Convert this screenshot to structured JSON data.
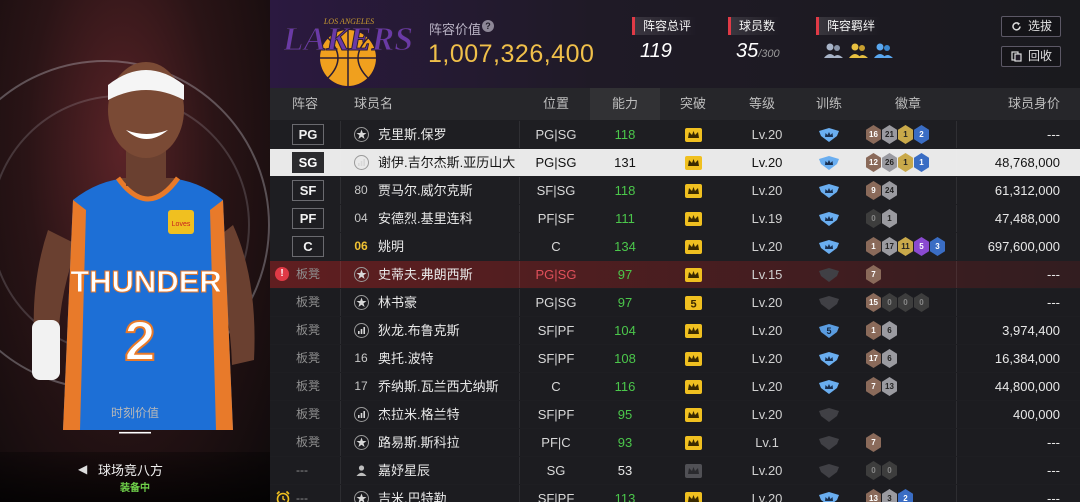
{
  "left_panel": {
    "moment_value_label": "时刻价值",
    "moment_value": "——",
    "court_name": "球场竞八方",
    "court_status": "装备中",
    "jersey_team": "THUNDER",
    "jersey_number": "2",
    "jersey_patch": "Loves"
  },
  "header": {
    "team_logo_text": "LAKERS",
    "team_logo_top": "LOS ANGELES",
    "lineup_value_label": "阵容价值",
    "help_icon": "?",
    "lineup_value": "1,007,326,400",
    "rating_label": "阵容总评",
    "rating_value": "119",
    "player_count_label": "球员数",
    "player_count_value": "35",
    "player_count_max": "/300",
    "bond_label": "阵容羁绊",
    "bond_icons": [
      "team-bond-icon-silver",
      "team-bond-icon-gold",
      "team-bond-icon-blue"
    ],
    "select_button": "选拔",
    "recycle_button": "回收"
  },
  "table": {
    "headers": {
      "role": "阵容",
      "name": "球员名",
      "position": "位置",
      "ability": "能力",
      "breakthrough": "突破",
      "level": "等级",
      "training": "训练",
      "badges": "徽章",
      "value": "球员身价"
    },
    "rows": [
      {
        "role": "PG",
        "type": "starter",
        "mark": "star",
        "name": "克里斯.保罗",
        "pos": "PG|SG",
        "ability": "118",
        "brk": "crown",
        "lv": "Lv.20",
        "train": "blue",
        "badges": [
          [
            "16",
            "bronze"
          ],
          [
            "21",
            "silver"
          ],
          [
            "1",
            "gold"
          ],
          [
            "2",
            "blue"
          ]
        ],
        "value": "---"
      },
      {
        "role": "SG",
        "type": "selected",
        "mark": "bars",
        "name": "谢伊.吉尔杰斯.亚历山大",
        "pos": "PG|SG",
        "ability": "131",
        "brk": "crown",
        "lv": "Lv.20",
        "train": "blue",
        "badges": [
          [
            "12",
            "bronze"
          ],
          [
            "26",
            "silver"
          ],
          [
            "1",
            "gold"
          ],
          [
            "1",
            "blue"
          ]
        ],
        "value": "48,768,000"
      },
      {
        "role": "SF",
        "type": "starter",
        "mark": "num",
        "num": "80",
        "name": "贾马尔.威尔克斯",
        "pos": "SF|SG",
        "ability": "118",
        "brk": "crown",
        "lv": "Lv.20",
        "train": "blue",
        "badges": [
          [
            "9",
            "bronze"
          ],
          [
            "24",
            "silver"
          ]
        ],
        "value": "61,312,000"
      },
      {
        "role": "PF",
        "type": "starter",
        "mark": "num",
        "num": "04",
        "name": "安德烈.基里连科",
        "pos": "PF|SF",
        "ability": "111",
        "brk": "crown",
        "lv": "Lv.19",
        "train": "blue",
        "badges": [
          [
            "0",
            "dark"
          ],
          [
            "1",
            "silver"
          ]
        ],
        "value": "47,488,000"
      },
      {
        "role": "C",
        "type": "starter",
        "mark": "num",
        "num": "06",
        "numgold": true,
        "name": "姚明",
        "pos": "C",
        "ability": "134",
        "brk": "crown",
        "lv": "Lv.20",
        "train": "blue",
        "badges": [
          [
            "1",
            "bronze"
          ],
          [
            "17",
            "silver"
          ],
          [
            "11",
            "gold"
          ],
          [
            "5",
            "purple"
          ],
          [
            "3",
            "blue"
          ]
        ],
        "value": "697,600,000"
      },
      {
        "role": "板凳",
        "type": "warn",
        "alert": "!",
        "mark": "star",
        "name": "史蒂夫.弗朗西斯",
        "pos": "PG|SG",
        "ability": "97",
        "brk": "crown",
        "lv": "Lv.15",
        "train": "gray",
        "badges": [
          [
            "7",
            "bronze"
          ]
        ],
        "value": "---"
      },
      {
        "role": "板凳",
        "type": "bench",
        "mark": "star",
        "name": "林书豪",
        "pos": "PG|SG",
        "ability": "97",
        "brk": "five",
        "lv": "Lv.20",
        "train": "gray",
        "badges": [
          [
            "15",
            "bronze"
          ],
          [
            "0",
            "dark"
          ],
          [
            "0",
            "dark"
          ],
          [
            "0",
            "dark"
          ]
        ],
        "value": "---"
      },
      {
        "role": "板凳",
        "type": "bench",
        "mark": "bars",
        "name": "狄龙.布鲁克斯",
        "pos": "SF|PF",
        "ability": "104",
        "brk": "crown",
        "lv": "Lv.20",
        "train": "five",
        "badges": [
          [
            "1",
            "bronze"
          ],
          [
            "6",
            "silver"
          ]
        ],
        "value": "3,974,400"
      },
      {
        "role": "板凳",
        "type": "bench",
        "mark": "num",
        "num": "16",
        "name": "奥托.波特",
        "pos": "SF|PF",
        "ability": "108",
        "brk": "crown",
        "lv": "Lv.20",
        "train": "blue",
        "badges": [
          [
            "17",
            "bronze"
          ],
          [
            "6",
            "silver"
          ]
        ],
        "value": "16,384,000"
      },
      {
        "role": "板凳",
        "type": "bench",
        "mark": "num",
        "num": "17",
        "name": "乔纳斯.瓦兰西尤纳斯",
        "pos": "C",
        "ability": "116",
        "brk": "crown",
        "lv": "Lv.20",
        "train": "blue",
        "badges": [
          [
            "7",
            "bronze"
          ],
          [
            "13",
            "silver"
          ]
        ],
        "value": "44,800,000"
      },
      {
        "role": "板凳",
        "type": "bench",
        "mark": "bars",
        "name": "杰拉米.格兰特",
        "pos": "SF|PF",
        "ability": "95",
        "brk": "crown",
        "lv": "Lv.20",
        "train": "gray",
        "badges": [],
        "value": "400,000"
      },
      {
        "role": "板凳",
        "type": "bench",
        "mark": "star",
        "name": "路易斯.斯科拉",
        "pos": "PF|C",
        "ability": "93",
        "brk": "crown",
        "lv": "Lv.1",
        "train": "gray",
        "badges": [
          [
            "7",
            "bronze"
          ]
        ],
        "value": "---"
      },
      {
        "role": "---",
        "type": "bench",
        "mark": "person",
        "name": "嘉妤星辰",
        "pos": "SG",
        "ability": "53",
        "abilitywhite": true,
        "brk": "gray",
        "lv": "Lv.20",
        "train": "gray",
        "badges": [
          [
            "0",
            "dark"
          ],
          [
            "0",
            "dark"
          ]
        ],
        "value": "---"
      },
      {
        "role": "---",
        "type": "bench",
        "alarm": true,
        "mark": "star",
        "name": "吉米.巴特勒",
        "pos": "SF|PF",
        "ability": "113",
        "brk": "crown",
        "lv": "Lv.20",
        "train": "blue",
        "badges": [
          [
            "13",
            "bronze"
          ],
          [
            "3",
            "silver"
          ],
          [
            "2",
            "blue"
          ]
        ],
        "value": "---"
      }
    ]
  },
  "colors": {
    "accent_gold": "#f0c04a",
    "ability_green": "#4bc74b",
    "alert_red": "#e03a46",
    "equipped_green": "#6fd04a",
    "lakers_purple": "#5b2d8c"
  }
}
